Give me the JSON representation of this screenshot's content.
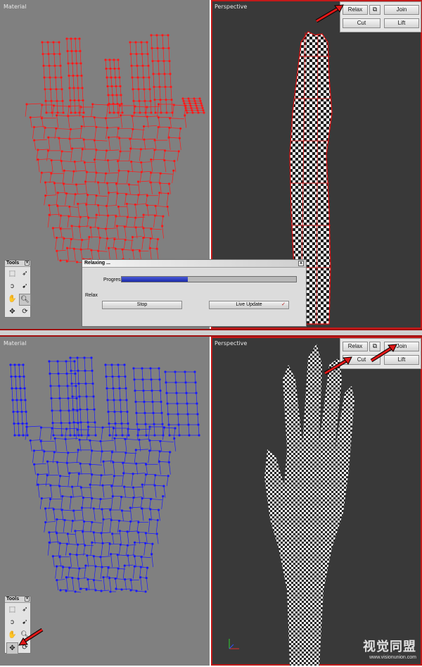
{
  "top": {
    "material_label": "Material",
    "perspective_label": "Perspective",
    "edit_panel": {
      "relax": "Relax",
      "join": "Join",
      "cut": "Cut",
      "lift": "Lift"
    }
  },
  "bottom": {
    "material_label": "Material",
    "perspective_label": "Perspective",
    "edit_panel": {
      "relax": "Relax",
      "join": "Join",
      "cut": "Cut",
      "lift": "Lift"
    }
  },
  "tools": {
    "title": "Tools",
    "close": "x"
  },
  "dialog": {
    "title": "Relaxing ...",
    "close": "x",
    "progress_label": "Progress:",
    "progress": 0.38,
    "relax_label": "Relax",
    "stop": "Stop",
    "live_update": "Live Update"
  },
  "watermark": {
    "main": "视觉同盟",
    "url": "www.visionunion.com"
  },
  "colors": {
    "wire_top": "#ff1a1a",
    "wire_bottom": "#1a1aff",
    "active_border": "#c21a1a"
  },
  "icons": {
    "tools": [
      "rect-select-icon",
      "pointer-icon",
      "lasso-icon",
      "pointer-arrow-icon",
      "hand-pan-icon",
      "zoom-icon",
      "move-icon",
      "rotate-icon"
    ],
    "edit": "split-icon"
  }
}
